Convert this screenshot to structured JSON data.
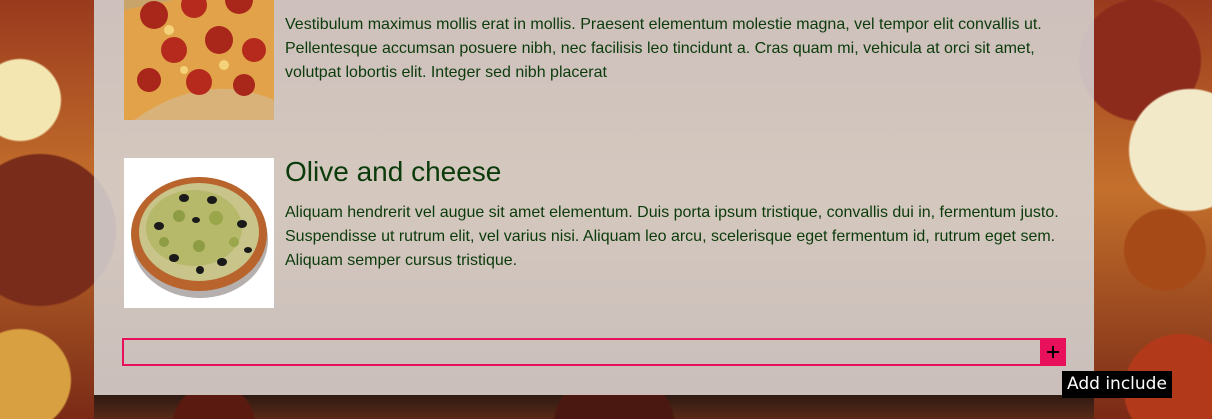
{
  "items": [
    {
      "title": "",
      "text": "Vestibulum maximus mollis erat in mollis. Praesent elementum molestie magna, vel tempor elit convallis ut. Pellentesque accumsan posuere nibh, nec facilisis leo tincidunt a. Cras quam mi, vehicula at orci sit amet, volutpat lobortis elit. Integer sed nibh placerat",
      "image_icon": "pepperoni-pizza-image"
    },
    {
      "title": "Olive and cheese",
      "text": "Aliquam hendrerit vel augue sit amet elementum. Duis porta ipsum tristique, convallis dui in, fermentum justo. Suspendisse ut rutrum elit, vel varius nisi. Aliquam leo arcu, scelerisque eget fermentum id, rutrum eget sem. Aliquam semper cursus tristique.",
      "image_icon": "olive-cheese-pizza-image"
    }
  ],
  "include": {
    "button_label": "+",
    "tooltip": "Add include"
  },
  "colors": {
    "accent": "#e8105a",
    "text": "#0b3a0b",
    "panel": "#d6d6d6"
  }
}
